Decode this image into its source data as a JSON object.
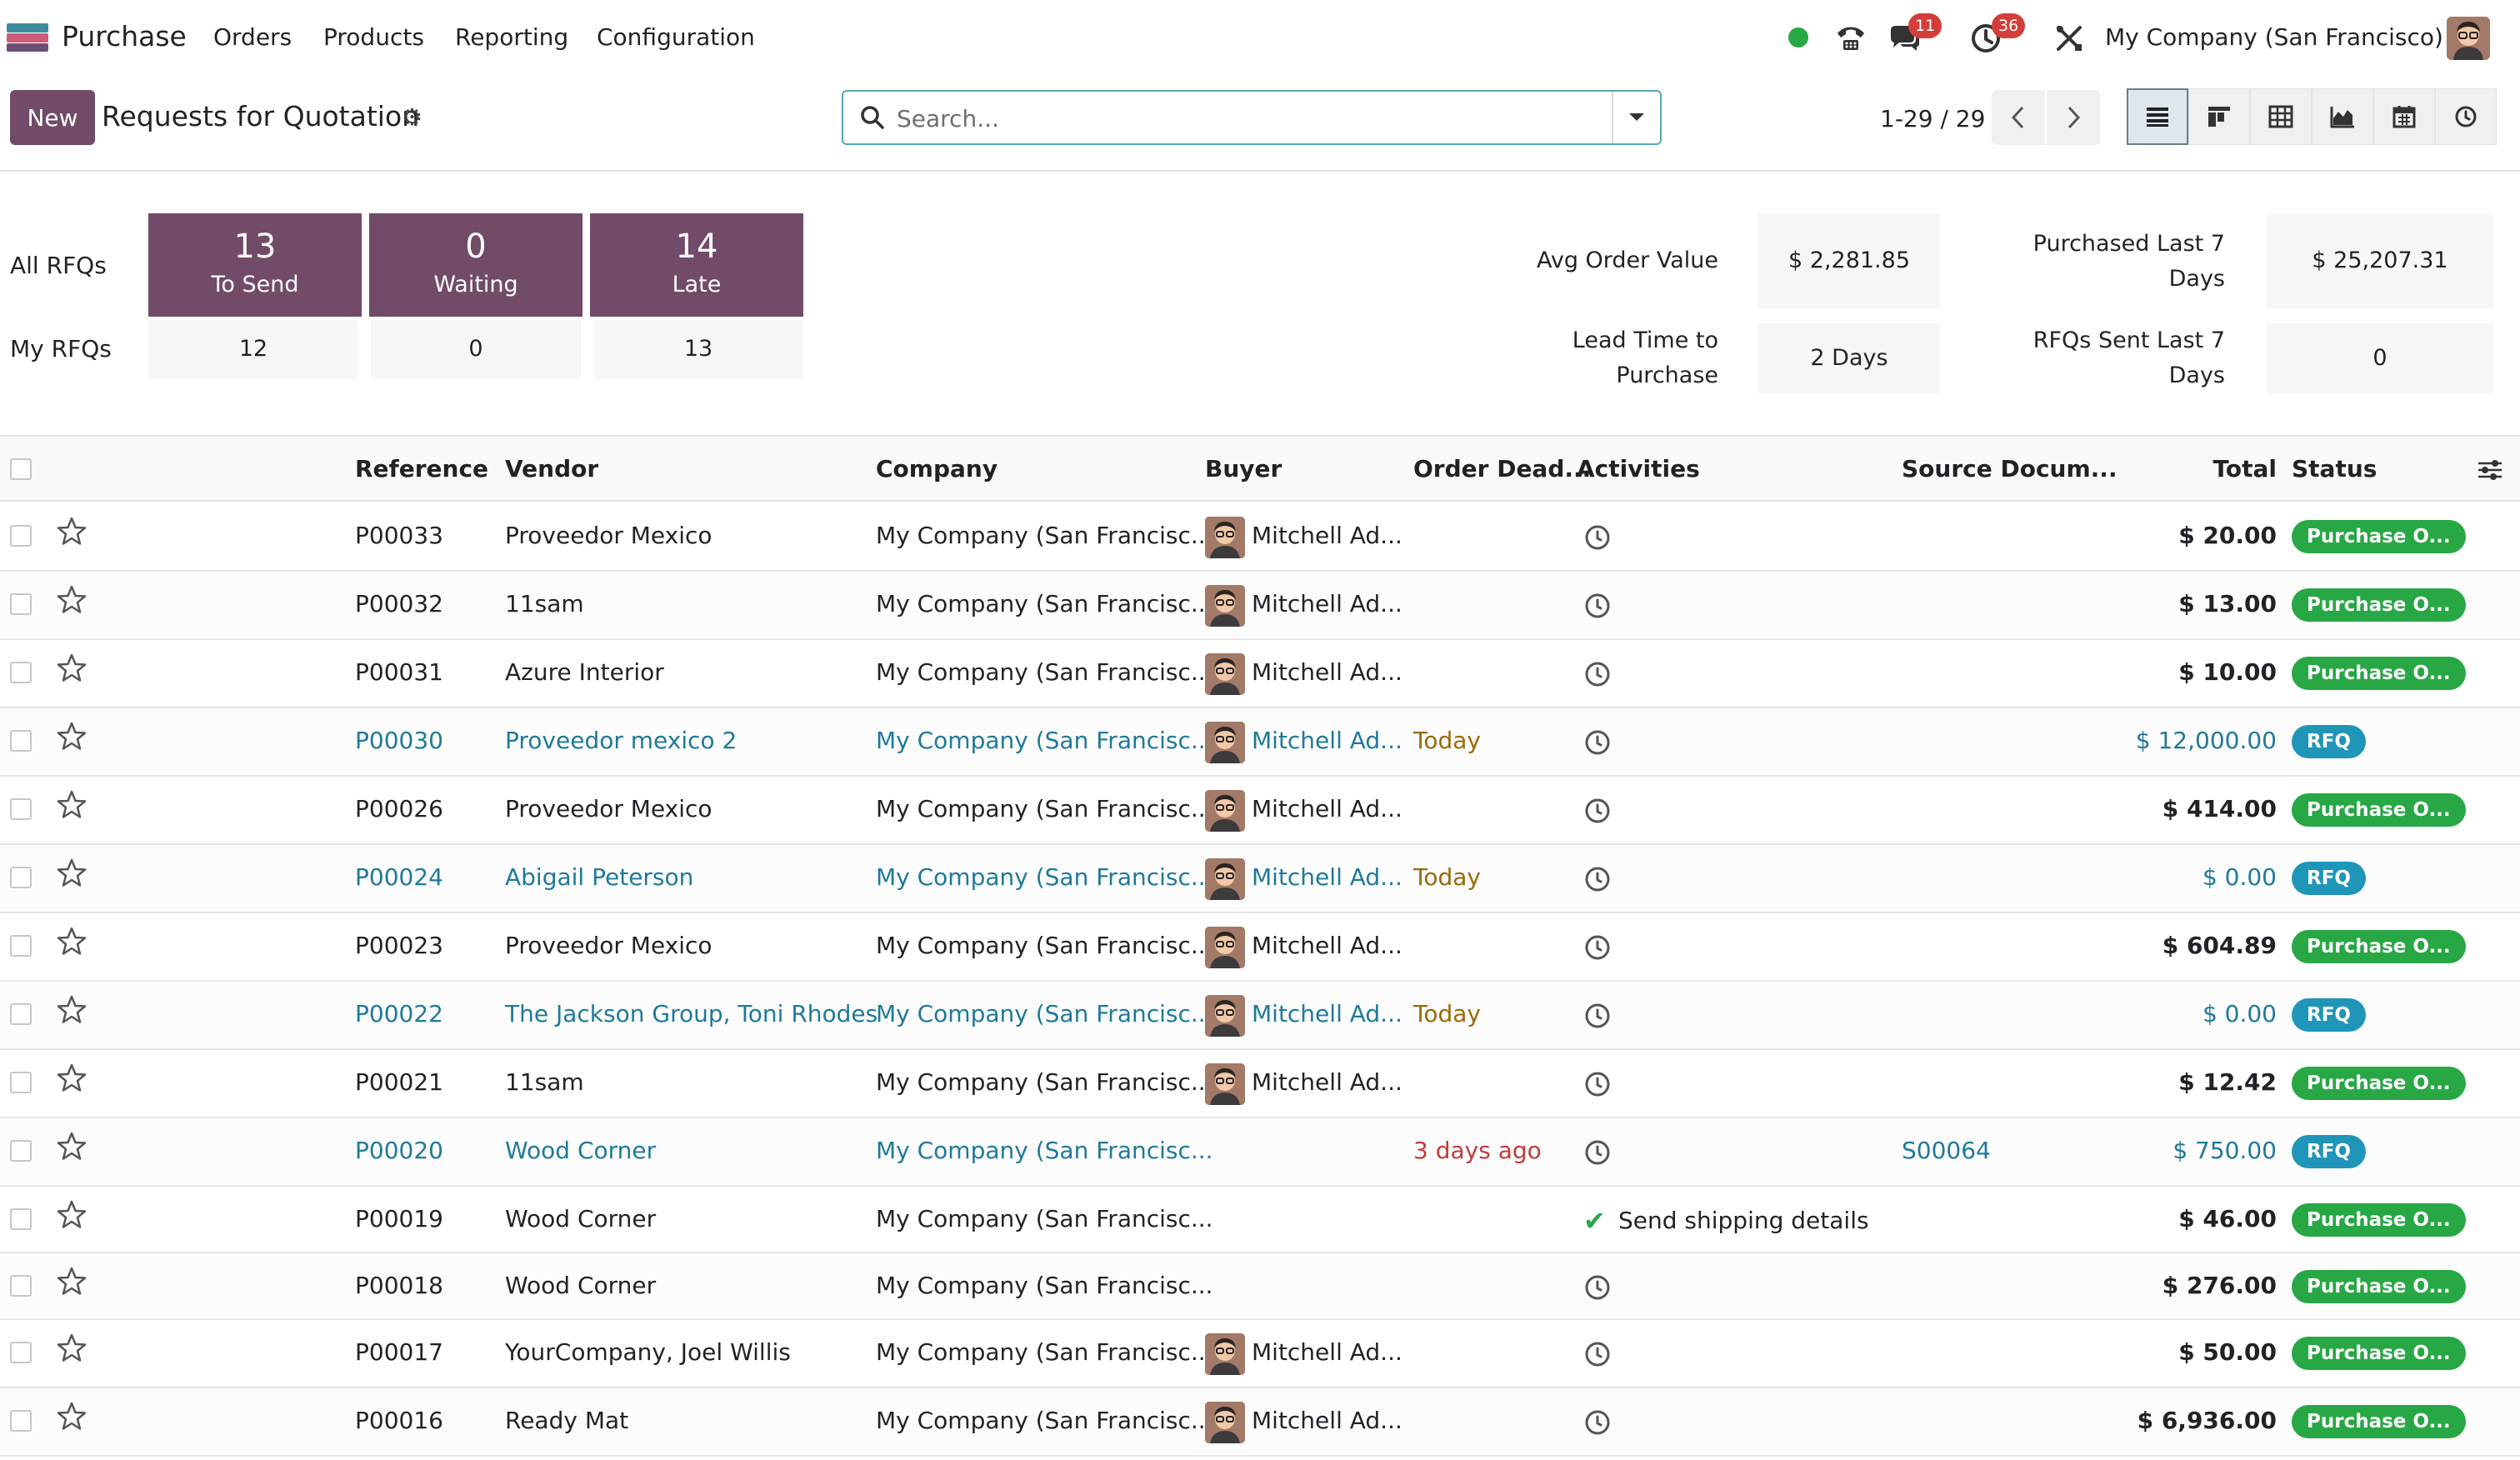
{
  "nav": {
    "app_name": "Purchase",
    "menu": [
      "Orders",
      "Products",
      "Reporting",
      "Configuration"
    ],
    "messages_count": "11",
    "activities_count": "36",
    "company": "My Company (San Francisco)"
  },
  "control": {
    "new_label": "New",
    "title": "Requests for Quotation",
    "search_placeholder": "Search...",
    "pager": "1-29 / 29",
    "views": [
      "list",
      "kanban",
      "pivot",
      "graph",
      "calendar",
      "activity"
    ]
  },
  "dashboard": {
    "all_label": "All RFQs",
    "my_label": "My RFQs",
    "tiles": [
      {
        "value": "13",
        "label": "To Send",
        "my": "12"
      },
      {
        "value": "0",
        "label": "Waiting",
        "my": "0"
      },
      {
        "value": "14",
        "label": "Late",
        "my": "13"
      }
    ],
    "kpis": {
      "avg_label": "Avg Order Value",
      "avg_value": "$ 2,281.85",
      "purchased_label_1": "Purchased Last 7",
      "purchased_label_2": "Days",
      "purchased_value": "$ 25,207.31",
      "lead_label_1": "Lead Time to",
      "lead_label_2": "Purchase",
      "lead_value": "2 Days",
      "rfqs_label_1": "RFQs Sent Last 7",
      "rfqs_label_2": "Days",
      "rfqs_value": "0"
    }
  },
  "table": {
    "columns": {
      "reference": "Reference",
      "vendor": "Vendor",
      "company": "Company",
      "buyer": "Buyer",
      "deadline": "Order Dead...",
      "activities": "Activities",
      "source": "Source Docum...",
      "total": "Total",
      "status": "Status"
    },
    "rows": [
      {
        "ref": "P00033",
        "vendor": "Proveedor Mexico",
        "company": "My Company (San Francisc...",
        "buyer": "Mitchell Ad...",
        "deadline": "",
        "activity": "",
        "source": "",
        "total": "$ 20.00",
        "status": "Purchase O...",
        "rfq": false
      },
      {
        "ref": "P00032",
        "vendor": "11sam",
        "company": "My Company (San Francisc...",
        "buyer": "Mitchell Ad...",
        "deadline": "",
        "activity": "",
        "source": "",
        "total": "$ 13.00",
        "status": "Purchase O...",
        "rfq": false
      },
      {
        "ref": "P00031",
        "vendor": "Azure Interior",
        "company": "My Company (San Francisc...",
        "buyer": "Mitchell Ad...",
        "deadline": "",
        "activity": "",
        "source": "",
        "total": "$ 10.00",
        "status": "Purchase O...",
        "rfq": false
      },
      {
        "ref": "P00030",
        "vendor": "Proveedor mexico 2",
        "company": "My Company (San Francisc...",
        "buyer": "Mitchell Ad...",
        "deadline": "Today",
        "activity": "",
        "source": "",
        "total": "$ 12,000.00",
        "status": "RFQ",
        "rfq": true
      },
      {
        "ref": "P00026",
        "vendor": "Proveedor Mexico",
        "company": "My Company (San Francisc...",
        "buyer": "Mitchell Ad...",
        "deadline": "",
        "activity": "",
        "source": "",
        "total": "$ 414.00",
        "status": "Purchase O...",
        "rfq": false
      },
      {
        "ref": "P00024",
        "vendor": "Abigail Peterson",
        "company": "My Company (San Francisc...",
        "buyer": "Mitchell Ad...",
        "deadline": "Today",
        "activity": "",
        "source": "",
        "total": "$ 0.00",
        "status": "RFQ",
        "rfq": true
      },
      {
        "ref": "P00023",
        "vendor": "Proveedor Mexico",
        "company": "My Company (San Francisc...",
        "buyer": "Mitchell Ad...",
        "deadline": "",
        "activity": "",
        "source": "",
        "total": "$ 604.89",
        "status": "Purchase O...",
        "rfq": false
      },
      {
        "ref": "P00022",
        "vendor": "The Jackson Group, Toni Rhodes",
        "company": "My Company (San Francisc...",
        "buyer": "Mitchell Ad...",
        "deadline": "Today",
        "activity": "",
        "source": "",
        "total": "$ 0.00",
        "status": "RFQ",
        "rfq": true
      },
      {
        "ref": "P00021",
        "vendor": "11sam",
        "company": "My Company (San Francisc...",
        "buyer": "Mitchell Ad...",
        "deadline": "",
        "activity": "",
        "source": "",
        "total": "$ 12.42",
        "status": "Purchase O...",
        "rfq": false
      },
      {
        "ref": "P00020",
        "vendor": "Wood Corner",
        "company": "My Company (San Francisc...",
        "buyer": "",
        "deadline": "3 days ago",
        "activity": "",
        "source": "S00064",
        "total": "$ 750.00",
        "status": "RFQ",
        "rfq": true
      },
      {
        "ref": "P00019",
        "vendor": "Wood Corner",
        "company": "My Company (San Francisc...",
        "buyer": "",
        "deadline": "",
        "activity": "Send shipping details",
        "source": "",
        "total": "$ 46.00",
        "status": "Purchase O...",
        "rfq": false
      },
      {
        "ref": "P00018",
        "vendor": "Wood Corner",
        "company": "My Company (San Francisc...",
        "buyer": "",
        "deadline": "",
        "activity": "",
        "source": "",
        "total": "$ 276.00",
        "status": "Purchase O...",
        "rfq": false
      },
      {
        "ref": "P00017",
        "vendor": "YourCompany, Joel Willis",
        "company": "My Company (San Francisc...",
        "buyer": "Mitchell Ad...",
        "deadline": "",
        "activity": "",
        "source": "",
        "total": "$ 50.00",
        "status": "Purchase O...",
        "rfq": false
      },
      {
        "ref": "P00016",
        "vendor": "Ready Mat",
        "company": "My Company (San Francisc...",
        "buyer": "Mitchell Ad...",
        "deadline": "",
        "activity": "",
        "source": "",
        "total": "$ 6,936.00",
        "status": "Purchase O...",
        "rfq": false
      }
    ]
  },
  "colors": {
    "brand": "#714b67",
    "rfq_link": "#1f7a99",
    "purchase_status": "#28a745",
    "rfq_status": "#1f95b8",
    "today": "#9a6b07",
    "late": "#c23b3b"
  }
}
